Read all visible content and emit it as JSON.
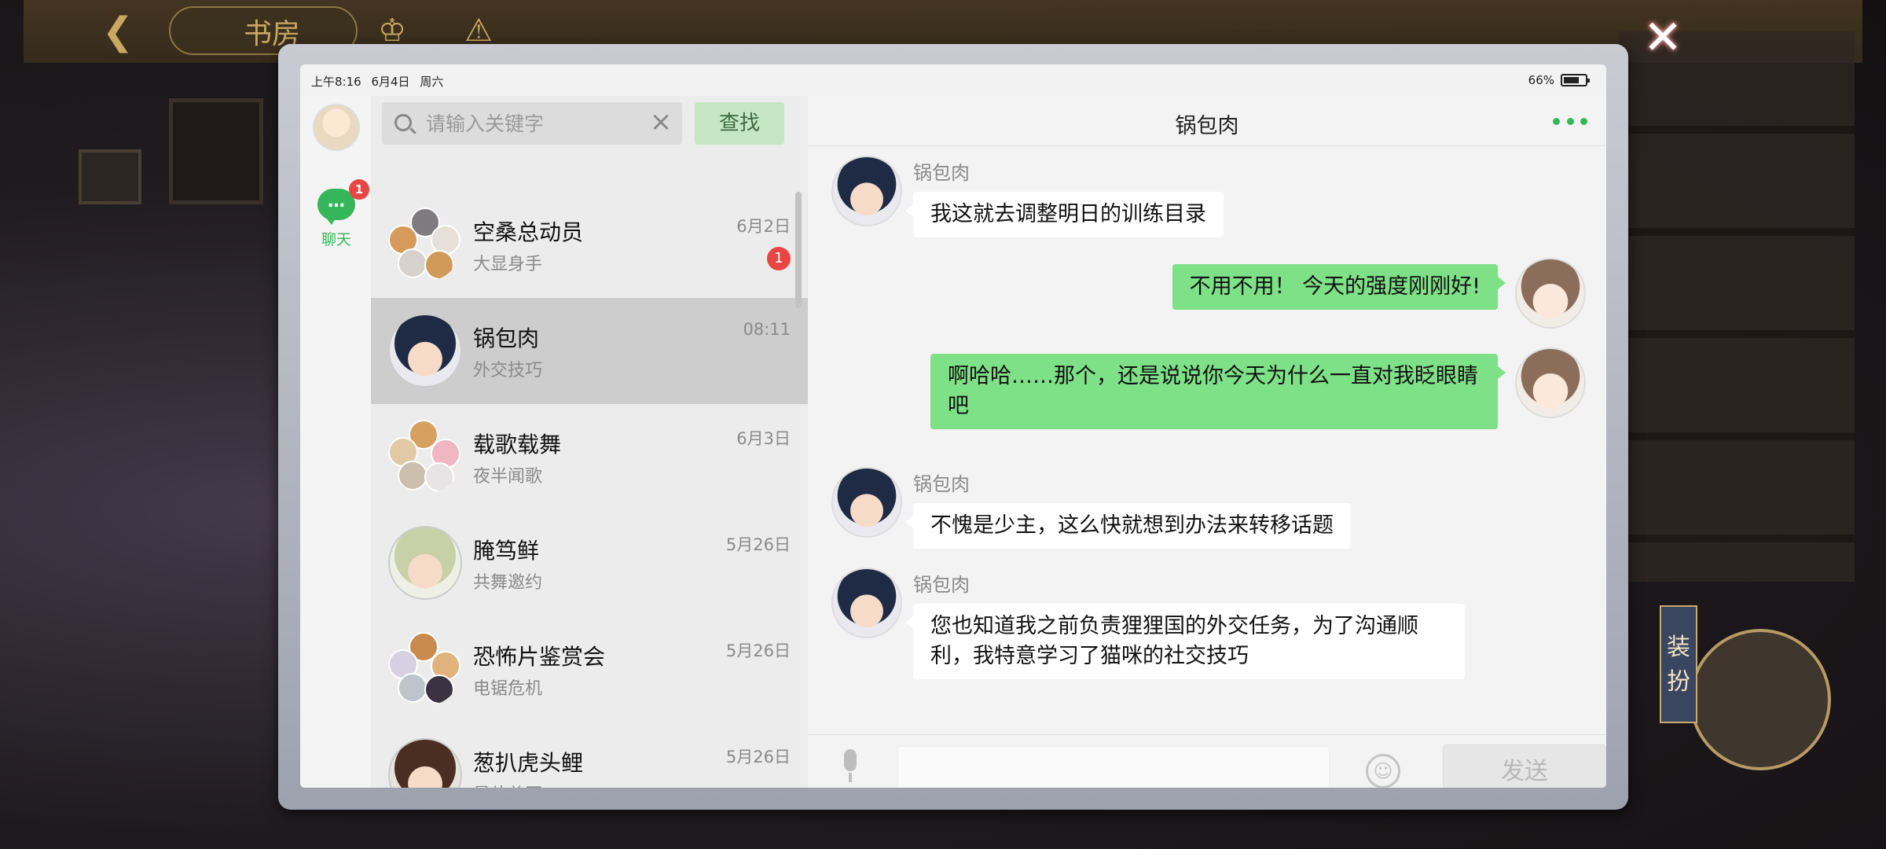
{
  "background": {
    "title_text": "书房",
    "costume_tag": "装扮"
  },
  "status_bar": {
    "time": "上午8:16",
    "date": "6月4日",
    "weekday": "周六",
    "battery": "66%"
  },
  "nav": {
    "chat_label": "聊天",
    "chat_badge": "1"
  },
  "search": {
    "placeholder": "请输入关键字",
    "button_label": "查找"
  },
  "conversations": [
    {
      "name": "空桑总动员",
      "subtitle": "大显身手",
      "time": "6月2日",
      "badge": "1",
      "avatar": "group"
    },
    {
      "name": "锅包肉",
      "subtitle": "外交技巧",
      "time": "08:11",
      "badge": "",
      "avatar": "single",
      "active": true
    },
    {
      "name": "载歌载舞",
      "subtitle": "夜半闻歌",
      "time": "6月3日",
      "badge": "",
      "avatar": "group"
    },
    {
      "name": "腌笃鲜",
      "subtitle": "共舞邀约",
      "time": "5月26日",
      "badge": "",
      "avatar": "single"
    },
    {
      "name": "恐怖片鉴赏会",
      "subtitle": "电锯危机",
      "time": "5月26日",
      "badge": "",
      "avatar": "group"
    },
    {
      "name": "葱扒虎头鲤",
      "subtitle": "最佳兽医",
      "time": "5月26日",
      "badge": "",
      "avatar": "single"
    }
  ],
  "chat": {
    "title": "锅包肉",
    "messages": [
      {
        "from": "other",
        "sender": "锅包肉",
        "text": "我这就去调整明日的训练目录"
      },
      {
        "from": "me",
        "sender": "",
        "text": "不用不用！ 今天的强度刚刚好!"
      },
      {
        "from": "me",
        "sender": "",
        "text": "啊哈哈……那个，还是说说你今天为什么一直对我眨眼睛吧"
      },
      {
        "from": "other",
        "sender": "锅包肉",
        "text": "不愧是少主，这么快就想到办法来转移话题"
      },
      {
        "from": "other",
        "sender": "锅包肉",
        "text": "您也知道我之前负责狸狸国的外交任务，为了沟通顺利，我特意学习了猫咪的社交技巧"
      }
    ],
    "input_value": "",
    "send_label": "发送"
  },
  "icons": {
    "close": "close-icon",
    "search": "search-icon",
    "clear": "clear-icon",
    "more": "more-icon",
    "mic": "mic-icon",
    "emoji": "emoji-icon"
  },
  "colors": {
    "accent_green": "#35b65a",
    "bubble_out": "#7ee087",
    "badge_red": "#e84545"
  }
}
